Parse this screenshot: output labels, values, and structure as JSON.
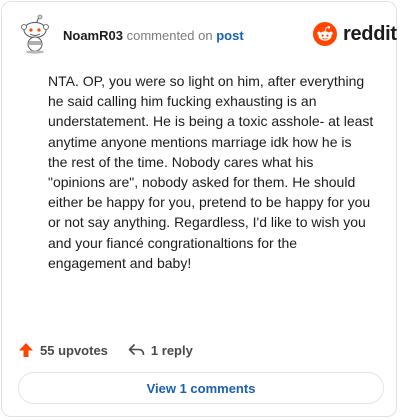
{
  "comment": {
    "author": "NoamR03",
    "action_text": "commented on",
    "link_text": "post",
    "body": "NTA. OP, you were so light on him, after everything he said calling him fucking exhausting is an understatement. He is being a toxic asshole- at least anytime anyone mentions marriage idk how he is the rest of the time. Nobody cares what his \"opinions are\", nobody asked for them. He should either be happy for you, pretend to be happy for you or not say anything. Regardless, I'd like to wish you and your fiancé congrationaltions for the engagement and baby!",
    "upvotes_label": "55 upvotes",
    "replies_label": "1 reply",
    "view_comments_label": "View 1 comments"
  },
  "brand": {
    "name": "reddit",
    "logo_icon": "reddit-snoo-icon",
    "accent_color": "#ff4500"
  },
  "icons": {
    "avatar": "snoo-avatar-icon",
    "upvote": "upvote-arrow-icon",
    "reply": "reply-arrow-icon"
  }
}
